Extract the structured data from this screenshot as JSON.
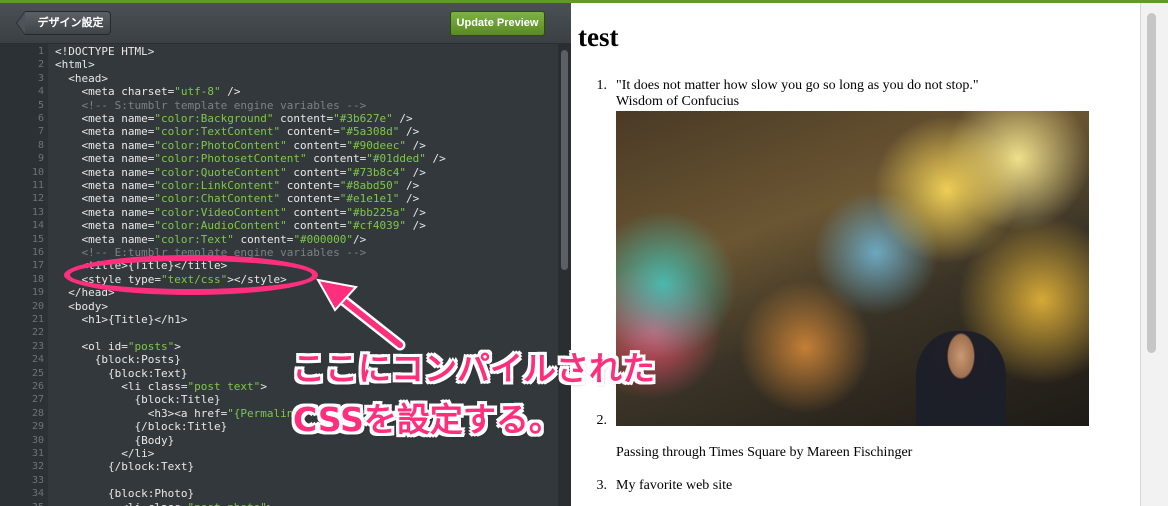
{
  "toolbar": {
    "back_label": "デザイン設定",
    "update_label": "Update Preview"
  },
  "code_lines": [
    {
      "n": "1",
      "segs": [
        {
          "t": "<!DOCTYPE HTML>",
          "c": ""
        }
      ]
    },
    {
      "n": "2",
      "segs": [
        {
          "t": "<html>",
          "c": ""
        }
      ]
    },
    {
      "n": "3",
      "segs": [
        {
          "t": "  <head>",
          "c": ""
        }
      ]
    },
    {
      "n": "4",
      "segs": [
        {
          "t": "    <meta charset=",
          "c": ""
        },
        {
          "t": "\"utf-8\"",
          "c": "str"
        },
        {
          "t": " />",
          "c": ""
        }
      ]
    },
    {
      "n": "5",
      "segs": [
        {
          "t": "    <!-- S:tumblr template engine variables -->",
          "c": "com"
        }
      ]
    },
    {
      "n": "6",
      "segs": [
        {
          "t": "    <meta name=",
          "c": ""
        },
        {
          "t": "\"color:Background\"",
          "c": "str"
        },
        {
          "t": " content=",
          "c": ""
        },
        {
          "t": "\"#3b627e\"",
          "c": "str"
        },
        {
          "t": " />",
          "c": ""
        }
      ]
    },
    {
      "n": "7",
      "segs": [
        {
          "t": "    <meta name=",
          "c": ""
        },
        {
          "t": "\"color:TextContent\"",
          "c": "str"
        },
        {
          "t": " content=",
          "c": ""
        },
        {
          "t": "\"#5a308d\"",
          "c": "str"
        },
        {
          "t": " />",
          "c": ""
        }
      ]
    },
    {
      "n": "8",
      "segs": [
        {
          "t": "    <meta name=",
          "c": ""
        },
        {
          "t": "\"color:PhotoContent\"",
          "c": "str"
        },
        {
          "t": " content=",
          "c": ""
        },
        {
          "t": "\"#90deec\"",
          "c": "str"
        },
        {
          "t": " />",
          "c": ""
        }
      ]
    },
    {
      "n": "9",
      "segs": [
        {
          "t": "    <meta name=",
          "c": ""
        },
        {
          "t": "\"color:PhotosetContent\"",
          "c": "str"
        },
        {
          "t": " content=",
          "c": ""
        },
        {
          "t": "\"#01dded\"",
          "c": "str"
        },
        {
          "t": " />",
          "c": ""
        }
      ]
    },
    {
      "n": "10",
      "segs": [
        {
          "t": "    <meta name=",
          "c": ""
        },
        {
          "t": "\"color:QuoteContent\"",
          "c": "str"
        },
        {
          "t": " content=",
          "c": ""
        },
        {
          "t": "\"#73b8c4\"",
          "c": "str"
        },
        {
          "t": " />",
          "c": ""
        }
      ]
    },
    {
      "n": "11",
      "segs": [
        {
          "t": "    <meta name=",
          "c": ""
        },
        {
          "t": "\"color:LinkContent\"",
          "c": "str"
        },
        {
          "t": " content=",
          "c": ""
        },
        {
          "t": "\"#8abd50\"",
          "c": "str"
        },
        {
          "t": " />",
          "c": ""
        }
      ]
    },
    {
      "n": "12",
      "segs": [
        {
          "t": "    <meta name=",
          "c": ""
        },
        {
          "t": "\"color:ChatContent\"",
          "c": "str"
        },
        {
          "t": " content=",
          "c": ""
        },
        {
          "t": "\"#e1e1e1\"",
          "c": "str"
        },
        {
          "t": " />",
          "c": ""
        }
      ]
    },
    {
      "n": "13",
      "segs": [
        {
          "t": "    <meta name=",
          "c": ""
        },
        {
          "t": "\"color:VideoContent\"",
          "c": "str"
        },
        {
          "t": " content=",
          "c": ""
        },
        {
          "t": "\"#bb225a\"",
          "c": "str"
        },
        {
          "t": " />",
          "c": ""
        }
      ]
    },
    {
      "n": "14",
      "segs": [
        {
          "t": "    <meta name=",
          "c": ""
        },
        {
          "t": "\"color:AudioContent\"",
          "c": "str"
        },
        {
          "t": " content=",
          "c": ""
        },
        {
          "t": "\"#cf4039\"",
          "c": "str"
        },
        {
          "t": " />",
          "c": ""
        }
      ]
    },
    {
      "n": "15",
      "segs": [
        {
          "t": "    <meta name=",
          "c": ""
        },
        {
          "t": "\"color:Text\"",
          "c": "str"
        },
        {
          "t": " content=",
          "c": ""
        },
        {
          "t": "\"#000000\"",
          "c": "str"
        },
        {
          "t": "/>",
          "c": ""
        }
      ]
    },
    {
      "n": "16",
      "segs": [
        {
          "t": "    <!-- E:tumblr template engine variables -->",
          "c": "com"
        }
      ]
    },
    {
      "n": "17",
      "segs": [
        {
          "t": "    <title>{Title}</title>",
          "c": ""
        }
      ]
    },
    {
      "n": "18",
      "segs": [
        {
          "t": "    <style type=",
          "c": ""
        },
        {
          "t": "\"text/css\"",
          "c": "str"
        },
        {
          "t": "></style>",
          "c": ""
        }
      ]
    },
    {
      "n": "19",
      "segs": [
        {
          "t": "  </head>",
          "c": ""
        }
      ]
    },
    {
      "n": "20",
      "segs": [
        {
          "t": "  <body>",
          "c": ""
        }
      ]
    },
    {
      "n": "21",
      "segs": [
        {
          "t": "    <h1>{Title}</h1>",
          "c": ""
        }
      ]
    },
    {
      "n": "22",
      "segs": [
        {
          "t": "",
          "c": ""
        }
      ]
    },
    {
      "n": "23",
      "segs": [
        {
          "t": "    <ol id=",
          "c": ""
        },
        {
          "t": "\"posts\"",
          "c": "str"
        },
        {
          "t": ">",
          "c": ""
        }
      ]
    },
    {
      "n": "24",
      "segs": [
        {
          "t": "      {block:Posts}",
          "c": ""
        }
      ]
    },
    {
      "n": "25",
      "segs": [
        {
          "t": "        {block:Text}",
          "c": ""
        }
      ]
    },
    {
      "n": "26",
      "segs": [
        {
          "t": "          <li class=",
          "c": ""
        },
        {
          "t": "\"post text\"",
          "c": "str"
        },
        {
          "t": ">",
          "c": ""
        }
      ]
    },
    {
      "n": "27",
      "segs": [
        {
          "t": "            {block:Title}",
          "c": ""
        }
      ]
    },
    {
      "n": "28",
      "segs": [
        {
          "t": "              <h3><a href=",
          "c": ""
        },
        {
          "t": "\"{Permalink}\"",
          "c": "str"
        },
        {
          "t": ">{Title}</a></h3>",
          "c": ""
        }
      ]
    },
    {
      "n": "29",
      "segs": [
        {
          "t": "            {/block:Title}",
          "c": ""
        }
      ]
    },
    {
      "n": "30",
      "segs": [
        {
          "t": "            {Body}",
          "c": ""
        }
      ]
    },
    {
      "n": "31",
      "segs": [
        {
          "t": "          </li>",
          "c": ""
        }
      ]
    },
    {
      "n": "32",
      "segs": [
        {
          "t": "        {/block:Text}",
          "c": ""
        }
      ]
    },
    {
      "n": "33",
      "segs": [
        {
          "t": "",
          "c": ""
        }
      ]
    },
    {
      "n": "34",
      "segs": [
        {
          "t": "        {block:Photo}",
          "c": ""
        }
      ]
    },
    {
      "n": "35",
      "segs": [
        {
          "t": "          <li class=",
          "c": ""
        },
        {
          "t": "\"post photo\"",
          "c": "str"
        },
        {
          "t": ">",
          "c": ""
        }
      ]
    }
  ],
  "preview": {
    "title": "test",
    "posts": [
      {
        "num": "1.",
        "lines": [
          "\"It does not matter how slow you go so long as you do not stop.\"",
          "Wisdom of Confucius"
        ]
      },
      {
        "num": "2.",
        "caption": "Passing through Times Square by Mareen Fischinger"
      },
      {
        "num": "3.",
        "text": "My favorite web site"
      }
    ]
  },
  "annotation": {
    "line1": "ここにコンパイルされた",
    "line2": "CSSを設定する。",
    "color": "#ff2f7e"
  },
  "colors": {
    "editor_bg": "#33383c",
    "accent_green": "#5f9a2e",
    "code_string": "#7ec84a",
    "code_comment": "#7b8186"
  }
}
